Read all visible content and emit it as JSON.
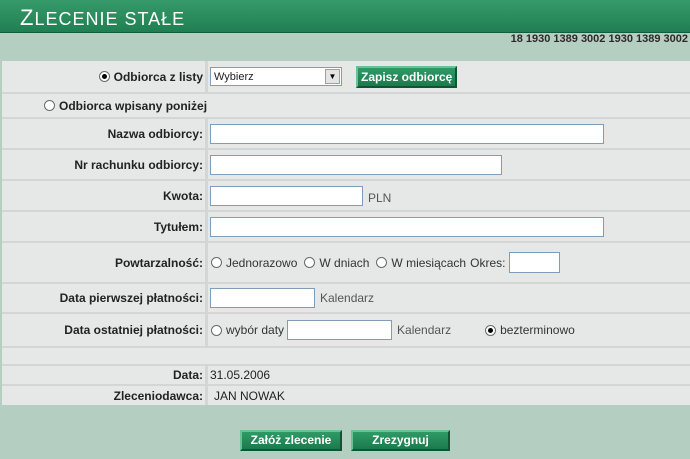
{
  "header": {
    "title_first": "Z",
    "title_rest": "LECENIE STAŁE",
    "account": "18 1930 1389 3002 1930 1389 3002"
  },
  "recipient": {
    "from_list_label": "Odbiorca z listy",
    "select_value": "Wybierz",
    "save_button": "Zapisz odbiorcę",
    "typed_label": "Odbiorca wpisany poniżej"
  },
  "fields": {
    "name_label": "Nazwa odbiorcy:",
    "account_label": "Nr rachunku odbiorcy:",
    "amount_label": "Kwota:",
    "currency": "PLN",
    "title_label": "Tytułem:",
    "repeat_label": "Powtarzalność:",
    "repeat_once": "Jednorazowo",
    "repeat_days": "W dniach",
    "repeat_months": "W miesiącach",
    "period_label": "Okres:",
    "first_date_label": "Data pierwszej płatności:",
    "calendar": "Kalendarz",
    "last_date_label": "Data ostatniej płatności:",
    "choose_date": "wybór daty",
    "indefinite": "bezterminowo"
  },
  "info": {
    "date_label": "Data:",
    "date_value": "31.05.2006",
    "principal_label": "Zleceniodawca:",
    "principal_value": "JAN NOWAK"
  },
  "buttons": {
    "submit": "Załóż zlecenie",
    "cancel": "Zrezygnuj"
  }
}
